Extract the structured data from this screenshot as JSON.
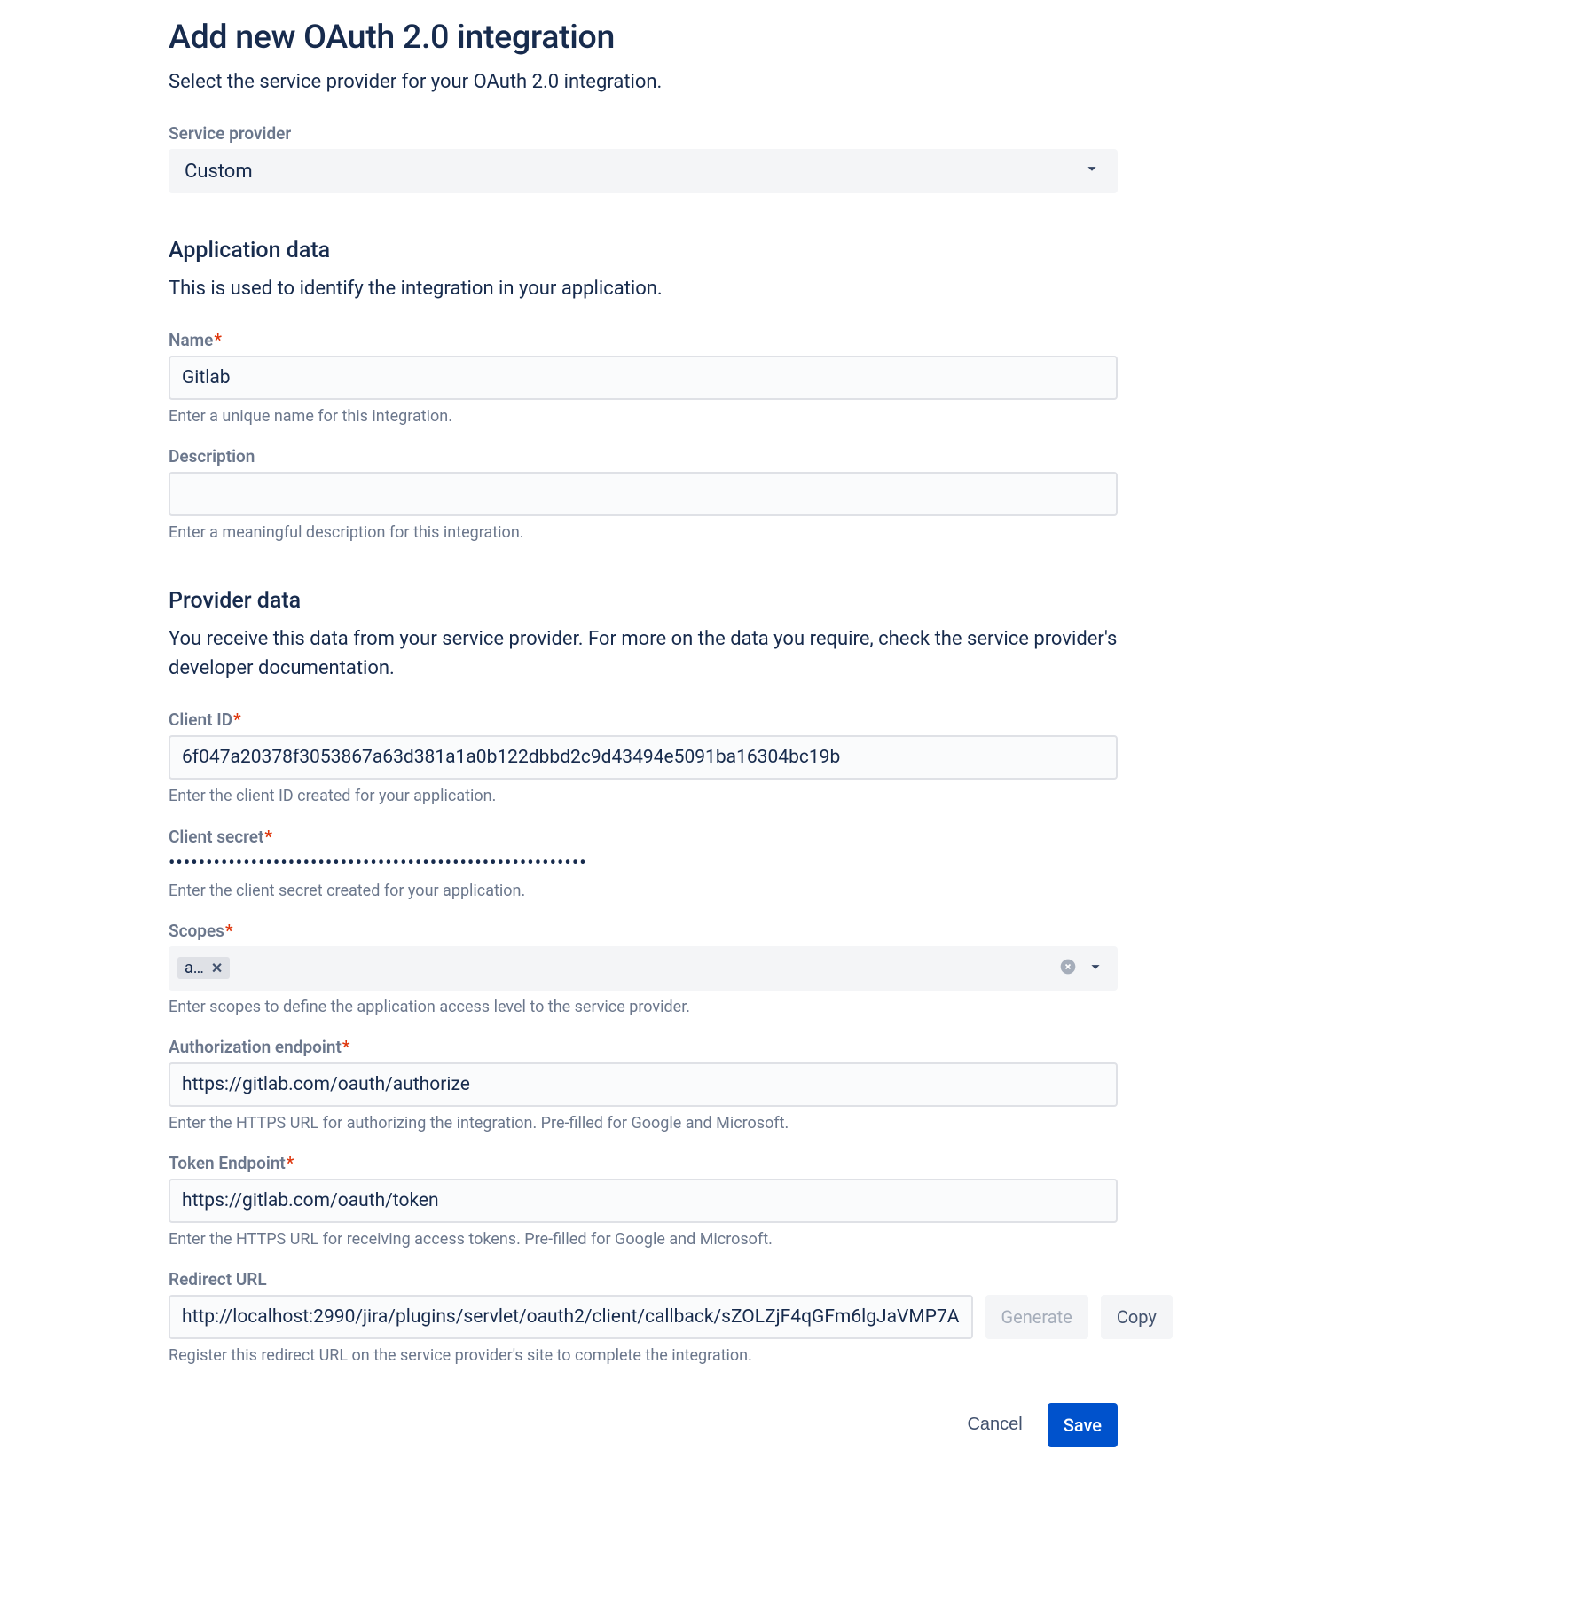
{
  "page": {
    "title": "Add new OAuth 2.0 integration",
    "subtitle": "Select the service provider for your OAuth 2.0 integration."
  },
  "serviceProvider": {
    "label": "Service provider",
    "value": "Custom"
  },
  "appData": {
    "heading": "Application data",
    "desc": "This is used to identify the integration in your application.",
    "name": {
      "label": "Name",
      "value": "Gitlab",
      "hint": "Enter a unique name for this integration."
    },
    "description": {
      "label": "Description",
      "value": "",
      "hint": "Enter a meaningful description for this integration."
    }
  },
  "providerData": {
    "heading": "Provider data",
    "desc": "You receive this data from your service provider. For more on the data you require, check the service provider's developer documentation.",
    "clientId": {
      "label": "Client ID",
      "value": "6f047a20378f3053867a63d381a1a0b122dbbd2c9d43494e5091ba16304bc19b",
      "hint": "Enter the client ID created for your application."
    },
    "clientSecret": {
      "label": "Client secret",
      "hint": "Enter the client secret created for your application."
    },
    "scopes": {
      "label": "Scopes",
      "tag": "a…",
      "hint": "Enter scopes to define the application access level to the service provider."
    },
    "authEndpoint": {
      "label": "Authorization endpoint",
      "value": "https://gitlab.com/oauth/authorize",
      "hint": "Enter the HTTPS URL for authorizing the integration. Pre-filled for Google and Microsoft."
    },
    "tokenEndpoint": {
      "label": "Token Endpoint",
      "value": "https://gitlab.com/oauth/token",
      "hint": "Enter the HTTPS URL for receiving access tokens. Pre-filled for Google and Microsoft."
    },
    "redirectUrl": {
      "label": "Redirect URL",
      "value": "http://localhost:2990/jira/plugins/servlet/oauth2/client/callback/sZOLZjF4qGFm6lgJaVMP7A",
      "hint": "Register this redirect URL on the service provider's site to complete the integration."
    }
  },
  "buttons": {
    "generate": "Generate",
    "copy": "Copy",
    "cancel": "Cancel",
    "save": "Save"
  }
}
